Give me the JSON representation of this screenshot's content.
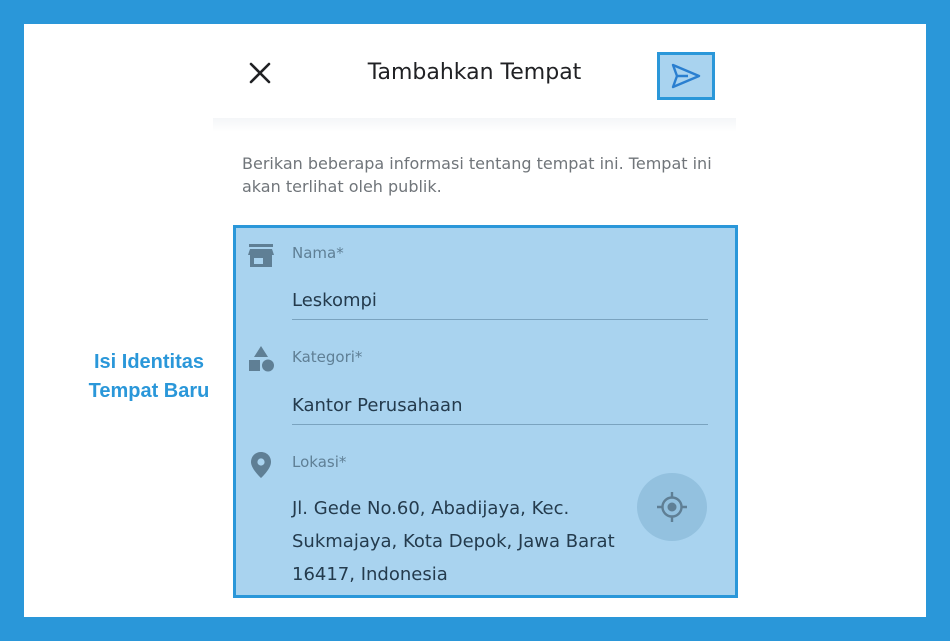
{
  "header": {
    "title": "Tambahkan Tempat",
    "close_icon": "close-icon",
    "send_icon": "send-icon"
  },
  "intro_text": "Berikan beberapa informasi tentang tempat ini. Tempat ini akan terlihat oleh publik.",
  "annotation": {
    "line1": "Isi Identitas",
    "line2": "Tempat Baru"
  },
  "form": {
    "name": {
      "label": "Nama*",
      "value": "Leskompi",
      "icon": "store-icon"
    },
    "category": {
      "label": "Kategori*",
      "value": "Kantor Perusahaan",
      "icon": "shapes-icon"
    },
    "location": {
      "label": "Lokasi*",
      "address_line1": "Jl. Gede No.60, Abadijaya, Kec.",
      "address_line2": "Sukmajaya, Kota Depok, Jawa Barat",
      "address_line3": "16417, Indonesia",
      "icon": "location-pin-icon",
      "locate_icon": "my-location-icon"
    }
  },
  "colors": {
    "accent": "#2a97d9",
    "highlight_fill": "#a9d3ef",
    "icon": "#5f7f95"
  }
}
